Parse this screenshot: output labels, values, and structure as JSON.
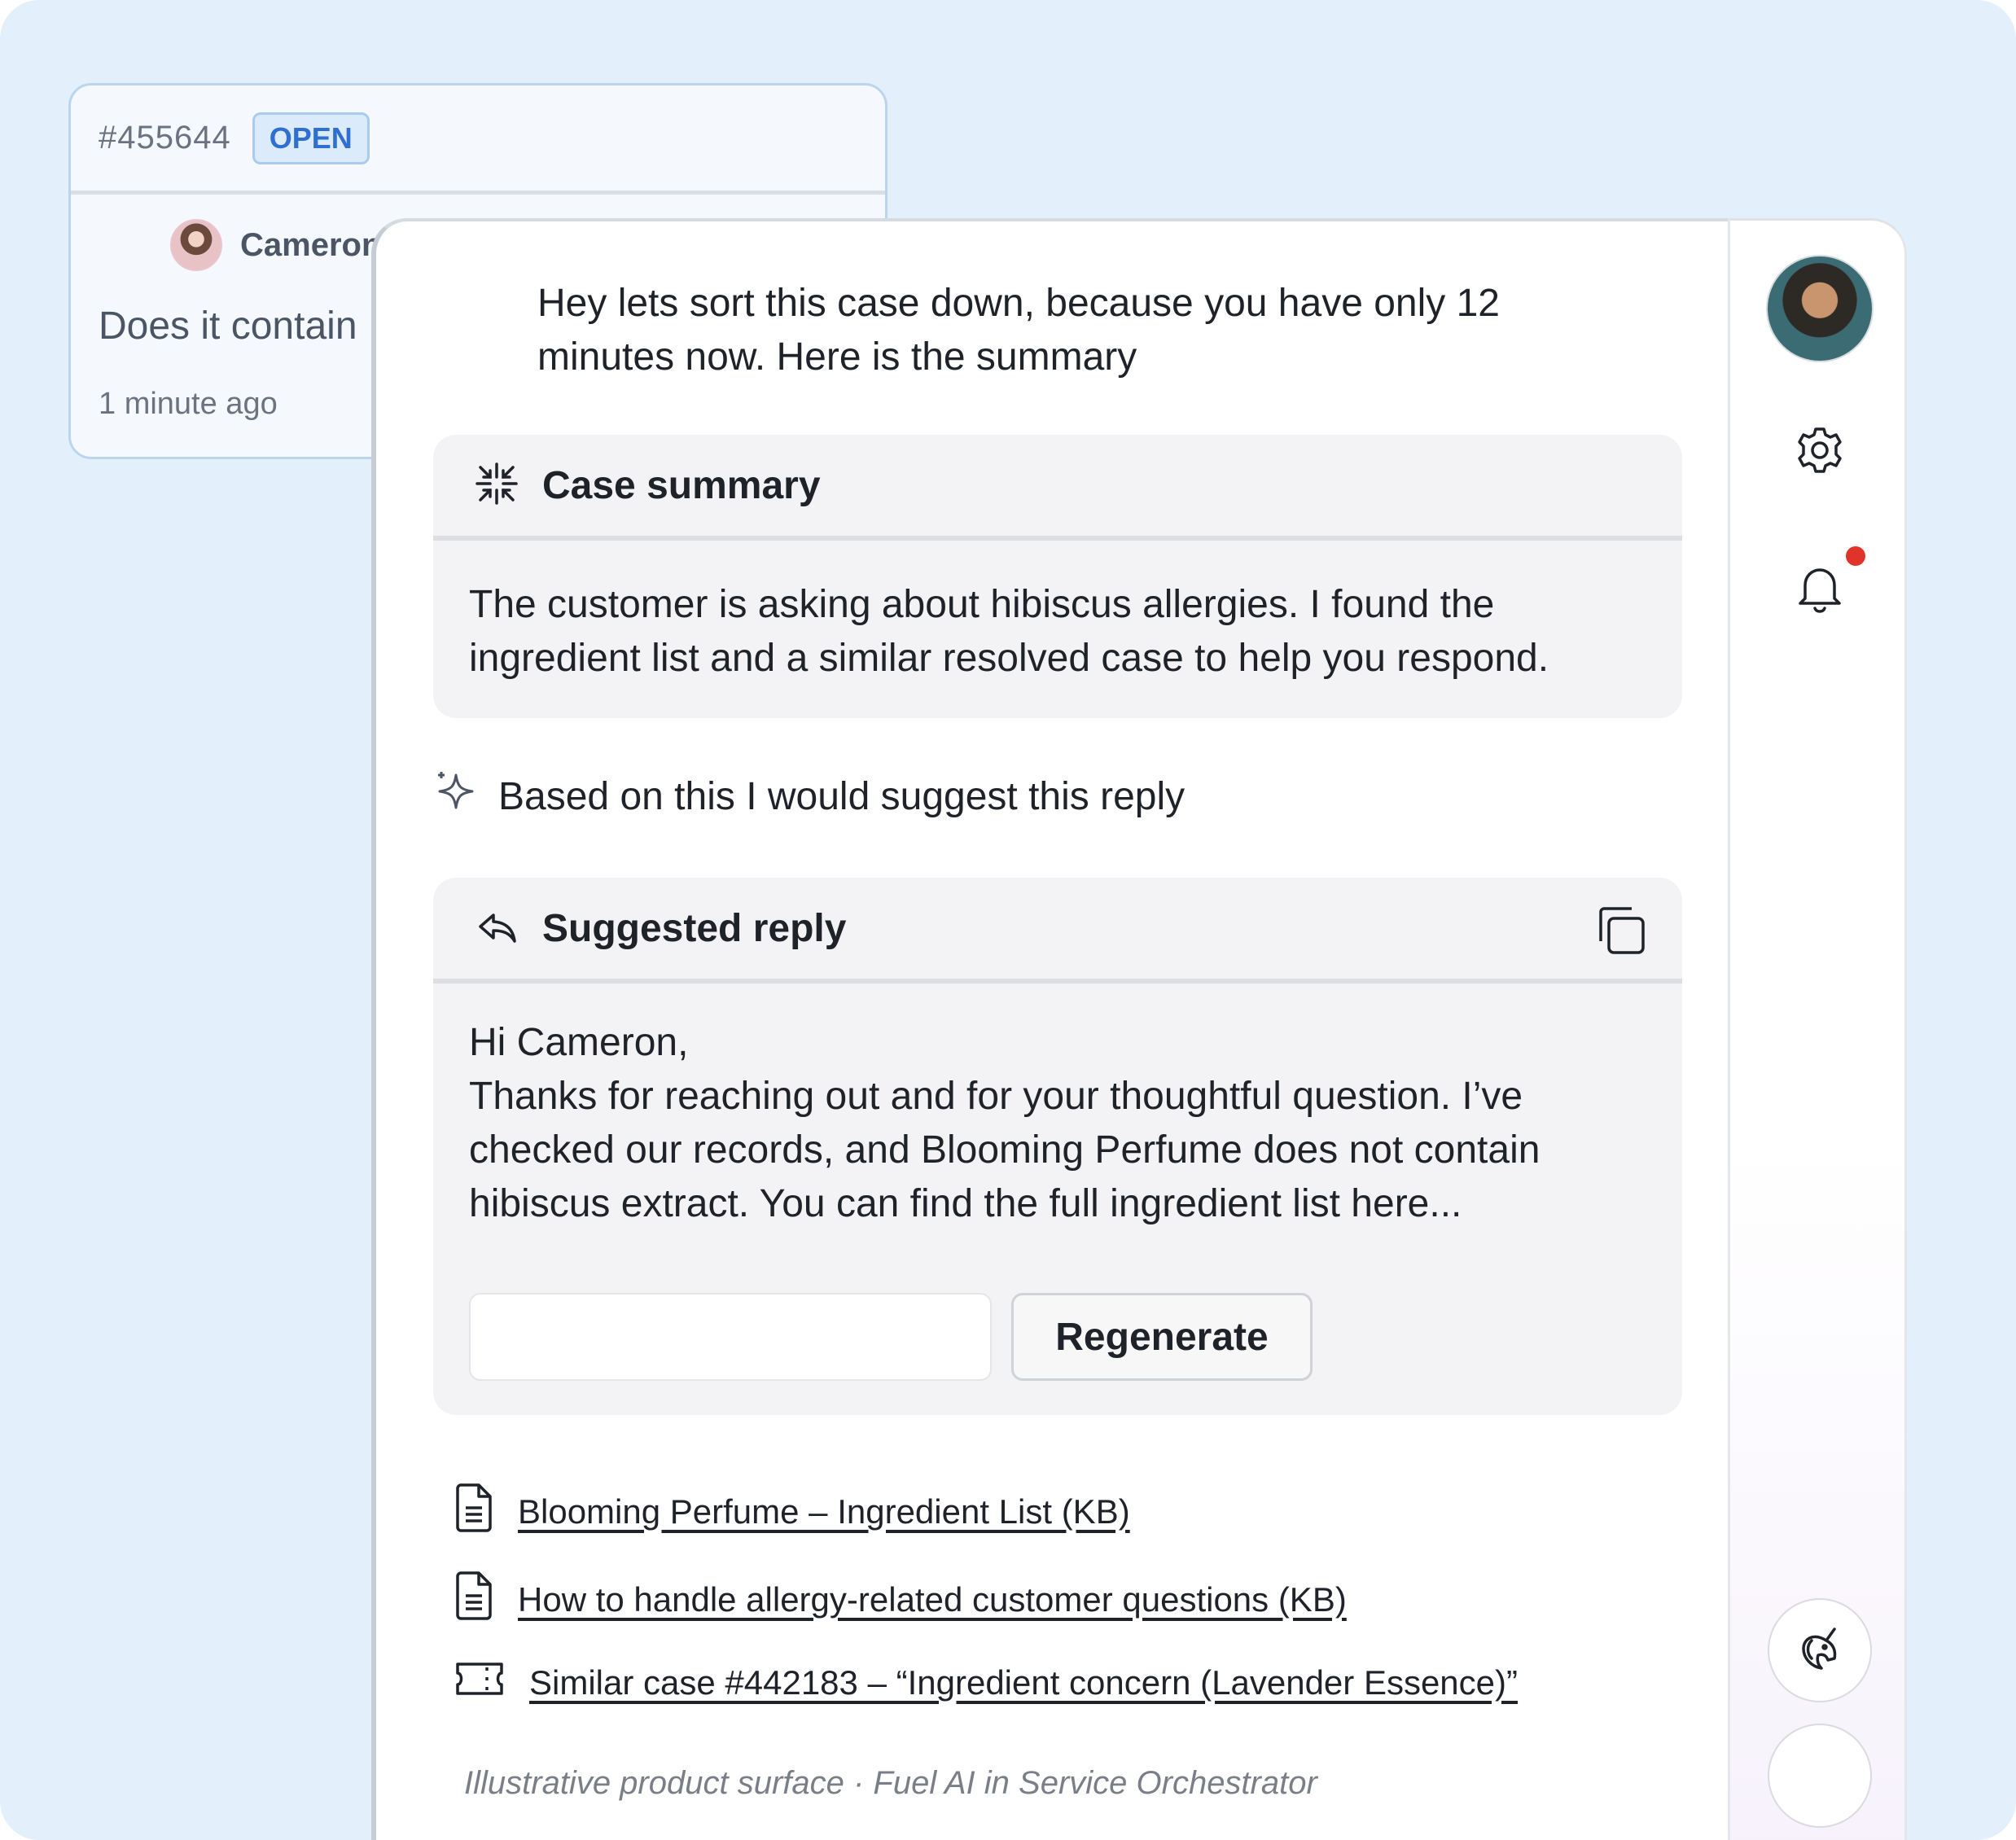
{
  "ticket": {
    "id": "#455644",
    "status": "OPEN",
    "author": "Cameron",
    "message": "Does it contain",
    "time": "1 minute ago"
  },
  "assistant": {
    "intro": "Hey lets sort this case down, because you have only 12 minutes now. Here is the summary",
    "summary": {
      "title": "Case summary",
      "body": "The customer is asking about hibiscus allergies. I found the ingredient list and a similar resolved case to help you respond."
    },
    "suggest_line": "Based on this I would suggest this reply",
    "reply": {
      "title": "Suggested reply",
      "greeting": "Hi Cameron,",
      "body": "Thanks for reaching out and for your thoughtful question. I’ve checked our records, and Blooming Perfume does not contain hibiscus extract. You can find the full ingredient list here...",
      "input_value": "",
      "regenerate_label": "Regenerate"
    },
    "sources": [
      {
        "label": "Blooming Perfume – Ingredient List (KB)",
        "icon": "document-icon"
      },
      {
        "label": "How to handle allergy-related customer questions (KB)",
        "icon": "document-icon"
      },
      {
        "label": "Similar case #442183 – “Ingredient concern (Lavender Essence)”",
        "icon": "ticket-icon"
      }
    ],
    "footer_note": "Illustrative product surface · Fuel AI in Service Orchestrator"
  },
  "rail": {
    "icons": [
      "avatar",
      "gear-icon",
      "bell-icon",
      "unicorn-icon"
    ],
    "notification_color": "#e0342b"
  },
  "colors": {
    "background": "#e3f0fc",
    "badge_text": "#2f6fd0",
    "badge_bg": "#dcebfb"
  }
}
